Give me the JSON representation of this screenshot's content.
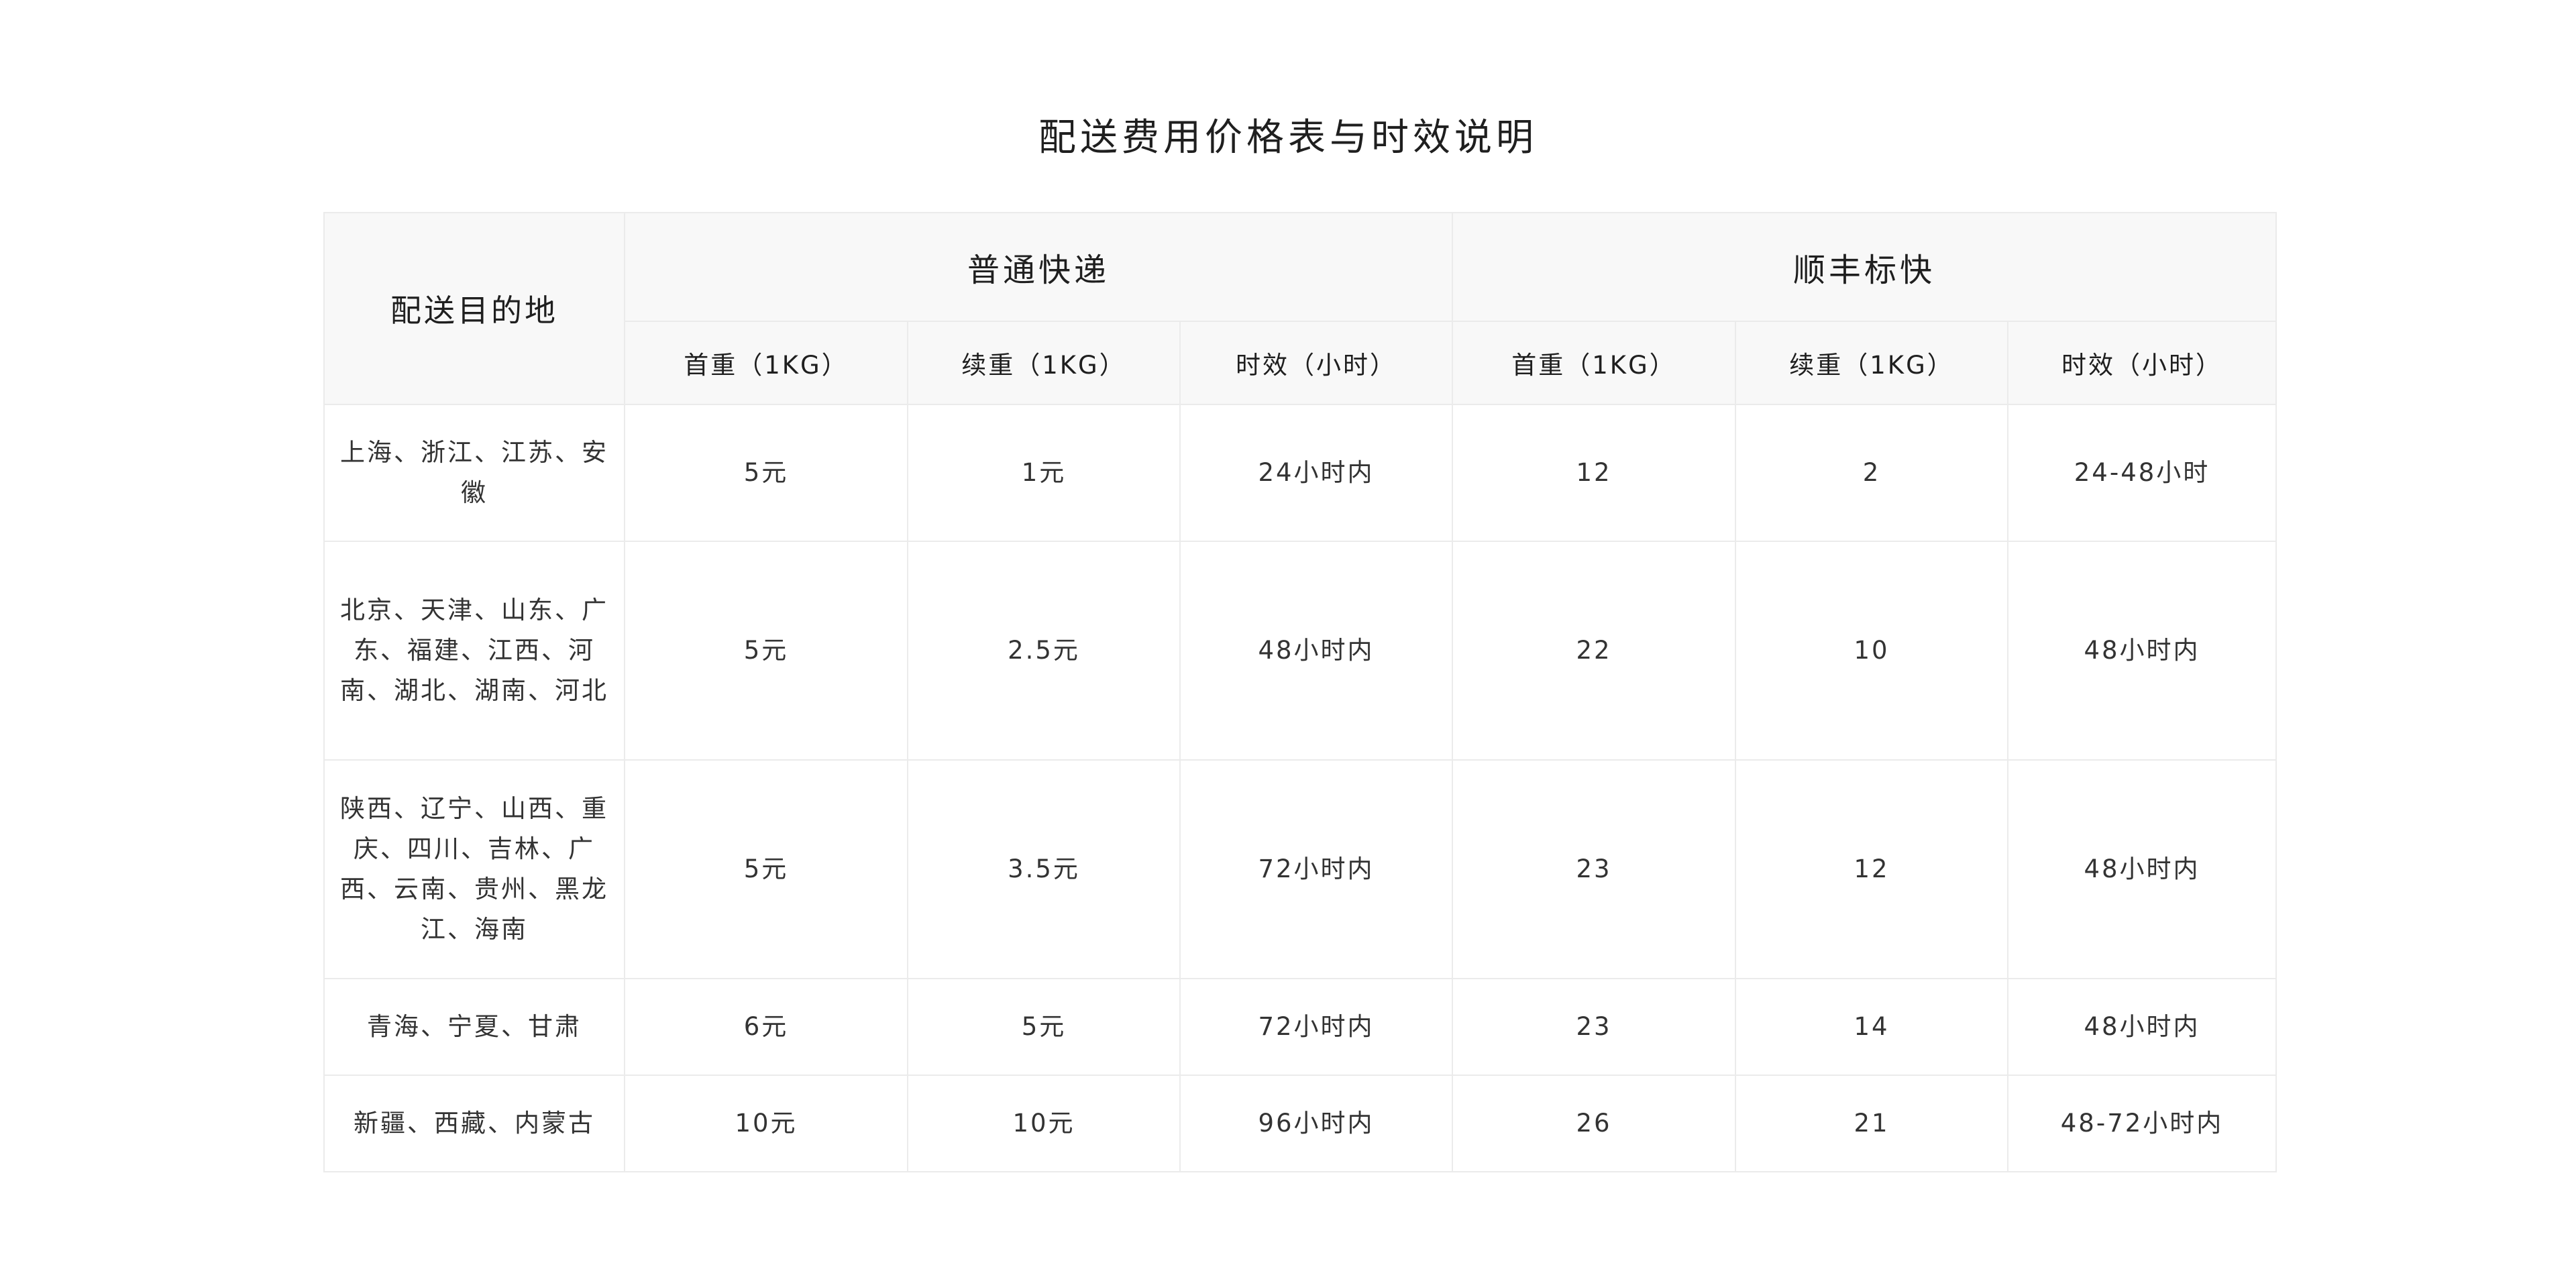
{
  "title": "配送费用价格表与时效说明",
  "table": {
    "destination_header": "配送目的地",
    "groups": [
      {
        "name": "普通快递",
        "columns": [
          "首重（1KG）",
          "续重（1KG）",
          "时效（小时）"
        ]
      },
      {
        "name": "顺丰标快",
        "columns": [
          "首重（1KG）",
          "续重（1KG）",
          "时效（小时）"
        ]
      }
    ],
    "rows": [
      {
        "destination": "上海、浙江、江苏、安徽",
        "cells": [
          "5元",
          "1元",
          "24小时内",
          "12",
          "2",
          "24-48小时"
        ]
      },
      {
        "destination": "北京、天津、山东、广东、福建、江西、河南、湖北、湖南、河北",
        "cells": [
          "5元",
          "2.5元",
          "48小时内",
          "22",
          "10",
          "48小时内"
        ]
      },
      {
        "destination": "陕西、辽宁、山西、重庆、四川、吉林、广西、云南、贵州、黑龙江、海南",
        "cells": [
          "5元",
          "3.5元",
          "72小时内",
          "23",
          "12",
          "48小时内"
        ]
      },
      {
        "destination": "青海、宁夏、甘肃",
        "cells": [
          "6元",
          "5元",
          "72小时内",
          "23",
          "14",
          "48小时内"
        ]
      },
      {
        "destination": "新疆、西藏、内蒙古",
        "cells": [
          "10元",
          "10元",
          "96小时内",
          "26",
          "21",
          "48-72小时内"
        ]
      }
    ]
  }
}
